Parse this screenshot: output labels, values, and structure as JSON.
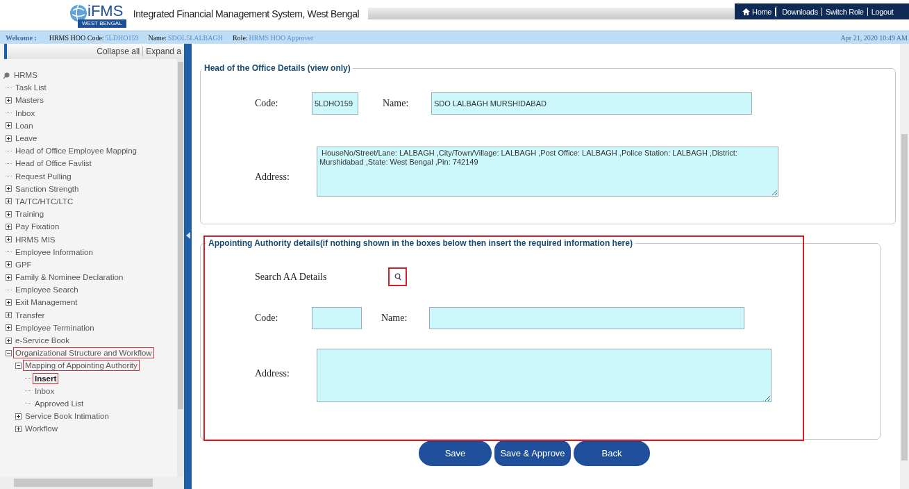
{
  "header": {
    "logo_text": "iFMS",
    "logo_subtext": "WEST BENGAL",
    "title": "Integrated Financial Management System, West Bengal",
    "nav": [
      {
        "label": "Home",
        "kind": "home"
      },
      {
        "label": "Downloads",
        "kind": "link"
      },
      {
        "label": "Switch Role",
        "kind": "link"
      },
      {
        "label": "Logout",
        "kind": "link"
      }
    ]
  },
  "info_bar": {
    "welcome": "Welcome :",
    "fields": [
      {
        "label": "HRMS HOO Code:",
        "value": "5LDHO159"
      },
      {
        "label": "Name:",
        "value": "SDOL5LALBAGH"
      },
      {
        "label": "Role:",
        "value": "HRMS HOO Approver"
      }
    ],
    "datetime": "Apr 21, 2020 10:49 AM"
  },
  "sidebar": {
    "collapse_all": "Collapse all",
    "expand_all": "Expand a",
    "tree": {
      "label": "HRMS",
      "children": [
        {
          "label": "Task List",
          "kind": "leaf",
          "selected": false,
          "highlighted": false
        },
        {
          "label": "Masters",
          "kind": "folder",
          "expanded": false,
          "selected": false,
          "highlighted": false
        },
        {
          "label": "Inbox",
          "kind": "leaf",
          "selected": false,
          "highlighted": false
        },
        {
          "label": "Loan",
          "kind": "folder",
          "expanded": false,
          "selected": false,
          "highlighted": false
        },
        {
          "label": "Leave",
          "kind": "folder",
          "expanded": false,
          "selected": false,
          "highlighted": false
        },
        {
          "label": "Head of Office Employee Mapping",
          "kind": "leaf",
          "selected": false,
          "highlighted": false
        },
        {
          "label": "Head of Office Favlist",
          "kind": "leaf",
          "selected": false,
          "highlighted": false
        },
        {
          "label": "Request Pulling",
          "kind": "leaf",
          "selected": false,
          "highlighted": false
        },
        {
          "label": "Sanction Strength",
          "kind": "folder",
          "expanded": false,
          "selected": false,
          "highlighted": false
        },
        {
          "label": "TA/TC/HTC/LTC",
          "kind": "folder",
          "expanded": false,
          "selected": false,
          "highlighted": false
        },
        {
          "label": "Training",
          "kind": "folder",
          "expanded": false,
          "selected": false,
          "highlighted": false
        },
        {
          "label": "Pay Fixation",
          "kind": "folder",
          "expanded": false,
          "selected": false,
          "highlighted": false
        },
        {
          "label": "HRMS MIS",
          "kind": "folder",
          "expanded": false,
          "selected": false,
          "highlighted": false
        },
        {
          "label": "Employee Information",
          "kind": "leaf",
          "selected": false,
          "highlighted": false
        },
        {
          "label": "GPF",
          "kind": "folder",
          "expanded": false,
          "selected": false,
          "highlighted": false
        },
        {
          "label": "Family & Nominee Declaration",
          "kind": "folder",
          "expanded": false,
          "selected": false,
          "highlighted": false
        },
        {
          "label": "Employee Search",
          "kind": "leaf",
          "selected": false,
          "highlighted": false
        },
        {
          "label": "Exit Management",
          "kind": "folder",
          "expanded": false,
          "selected": false,
          "highlighted": false
        },
        {
          "label": "Transfer",
          "kind": "folder",
          "expanded": false,
          "selected": false,
          "highlighted": false
        },
        {
          "label": "Employee Termination",
          "kind": "folder",
          "expanded": false,
          "selected": false,
          "highlighted": false
        },
        {
          "label": "e-Service Book",
          "kind": "folder",
          "expanded": false,
          "selected": false,
          "highlighted": false
        },
        {
          "label": "Organizational Structure and Workflow",
          "kind": "folder",
          "expanded": true,
          "selected": false,
          "highlighted": true,
          "children": [
            {
              "label": "Mapping of Appointing Authority",
              "kind": "folder",
              "expanded": true,
              "selected": false,
              "highlighted": true,
              "children": [
                {
                  "label": "Insert",
                  "kind": "leaf",
                  "selected": true,
                  "highlighted": true
                },
                {
                  "label": "Inbox",
                  "kind": "leaf",
                  "selected": false,
                  "highlighted": false
                },
                {
                  "label": "Approved List",
                  "kind": "leaf",
                  "selected": false,
                  "highlighted": false
                }
              ]
            },
            {
              "label": "Service Book Intimation",
              "kind": "folder",
              "expanded": false,
              "selected": false,
              "highlighted": false
            },
            {
              "label": "Workflow",
              "kind": "folder",
              "expanded": false,
              "selected": false,
              "highlighted": false
            }
          ]
        }
      ]
    }
  },
  "hoo_section": {
    "legend": "Head of the Office Details (view only)",
    "code_label": "Code:",
    "code_value": "5LDHO159",
    "name_label": "Name:",
    "name_value": "SDO LALBAGH MURSHIDABAD",
    "address_label": "Address:",
    "address_value": " HouseNo/Street/Lane: LALBAGH ,City/Town/Village: LALBAGH ,Post Office: LALBAGH ,Police Station: LALBAGH ,District: Murshidabad ,State: West Bengal ,Pin: 742149"
  },
  "aa_section": {
    "legend": "Appointing Authority details(if nothing shown in the boxes below then insert the required information here)",
    "highlighted": true,
    "search_label": "Search AA Details",
    "code_label": "Code:",
    "name_label": "Name:",
    "address_label": "Address:"
  },
  "buttons": [
    "Save",
    "Save & Approve",
    "Back"
  ]
}
